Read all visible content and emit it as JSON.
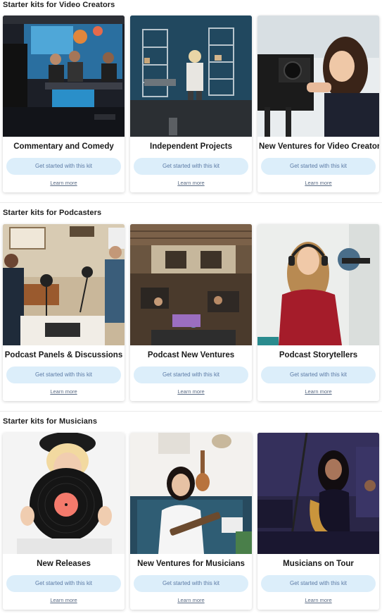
{
  "sections": [
    {
      "title": "Starter kits for Video Creators",
      "cards": [
        {
          "title": "Commentary and Comedy",
          "cta": "Get started with this kit",
          "link": "Learn more"
        },
        {
          "title": "Independent Projects",
          "cta": "Get started with this kit",
          "link": "Learn more"
        },
        {
          "title": "New Ventures for Video Creators",
          "cta": "Get started with this kit",
          "link": "Learn more"
        }
      ]
    },
    {
      "title": "Starter kits for Podcasters",
      "cards": [
        {
          "title": "Podcast Panels & Discussions",
          "cta": "Get started with this kit",
          "link": "Learn more"
        },
        {
          "title": "Podcast New Ventures",
          "cta": "Get started with this kit",
          "link": "Learn more"
        },
        {
          "title": "Podcast Storytellers",
          "cta": "Get started with this kit",
          "link": "Learn more"
        }
      ]
    },
    {
      "title": "Starter kits for Musicians",
      "cards": [
        {
          "title": "New Releases",
          "cta": "Get started with this kit",
          "link": "Learn more"
        },
        {
          "title": "New Ventures for Musicians",
          "cta": "Get started with this kit",
          "link": "Learn more"
        },
        {
          "title": "Musicians on Tour",
          "cta": "Get started with this kit",
          "link": "Learn more"
        }
      ]
    }
  ],
  "colors": {
    "cta_background": "#dceefa",
    "cta_text": "#5b7aa5",
    "link_text": "#5a6b84"
  }
}
